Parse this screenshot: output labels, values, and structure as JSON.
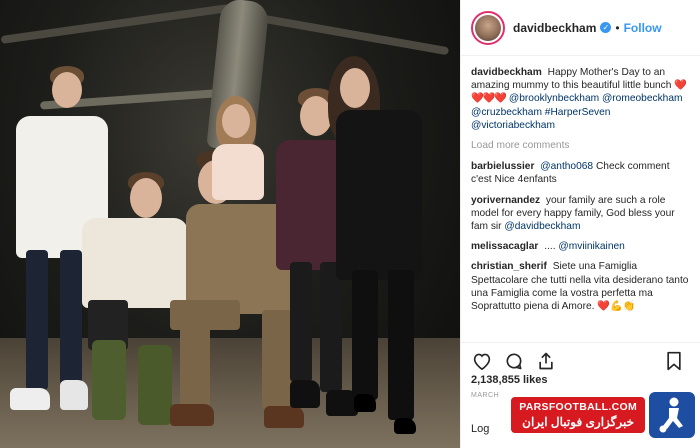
{
  "post": {
    "username": "davidbeckham",
    "follow_label": "Follow",
    "separator": "•",
    "caption_text": "Happy Mother's Day to an amazing mummy to this beautiful little bunch",
    "caption_hearts": "❤️❤️❤️❤️",
    "caption_mentions": [
      "@brooklynbeckham",
      "@romeobeckham",
      "@cruzbeckham",
      "#HarperSeven",
      "@victoriabeckham"
    ],
    "load_more_label": "Load more comments"
  },
  "comments": [
    {
      "user": "barbielussier",
      "mention": "@antho068",
      "text": "Check comment c'est Nice 4enfants"
    },
    {
      "user": "yorivernandez",
      "text": "your family are such a role model for every happy family, God bless your fam sir",
      "mention_end": "@davidbeckham"
    },
    {
      "user": "melissacaglar",
      "text": "....",
      "mention_end": "@mviinikainen"
    },
    {
      "user": "christian_sherif",
      "text": "Siete una Famiglia Spettacolare che tutti nella vita desiderano tanto una Famiglia come la vostra perfetta ma Soprattutto piena di Amore.",
      "emoji": "❤️💪👏"
    }
  ],
  "stats": {
    "likes": "2,138,855 likes",
    "date_label": "MARCH",
    "login_label": "Log"
  },
  "watermark": {
    "site": "PARSFOOTBALL.COM",
    "persian": "خبرگزاری فوتبال ایران"
  },
  "icons": {
    "like": "heart-icon",
    "comment": "comment-icon",
    "share": "share-icon",
    "save": "bookmark-icon",
    "verified": "verified-badge-icon"
  },
  "colors": {
    "link": "#003569",
    "follow": "#3897f0",
    "verified": "#3897f0",
    "heart": "#ed4956",
    "watermark_red": "#d71920",
    "watermark_blue": "#1e4ea1"
  }
}
